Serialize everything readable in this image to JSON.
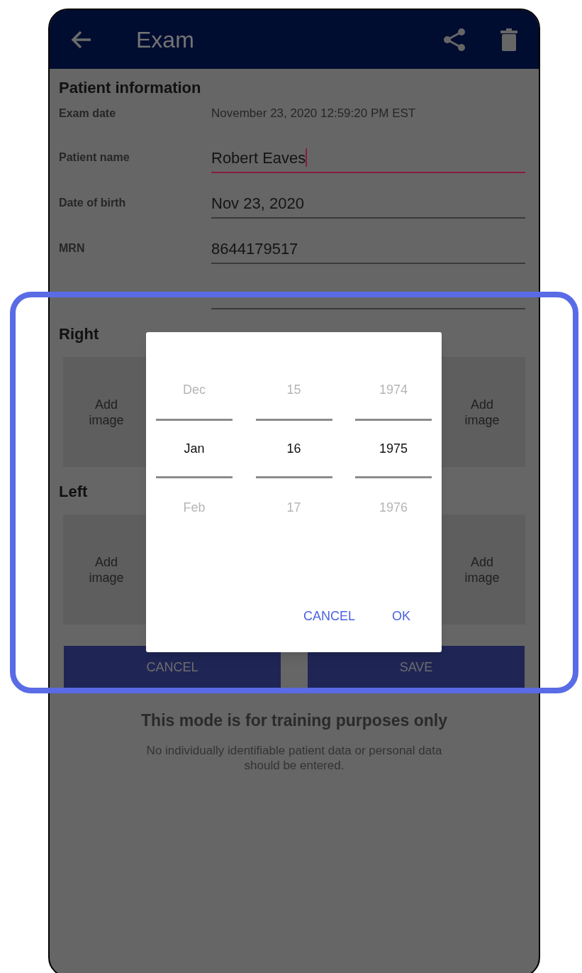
{
  "header": {
    "title": "Exam"
  },
  "section_title": "Patient information",
  "fields": [
    {
      "kind": "static",
      "label": "Exam date",
      "value": "November 23, 2020 12:59:20 PM EST"
    },
    {
      "kind": "input",
      "label": "Patient name",
      "value": "Robert Eaves",
      "focused": true
    },
    {
      "kind": "input",
      "label": "Date of birth",
      "value": "Nov 23, 2020",
      "focused": false
    },
    {
      "kind": "input",
      "label": "MRN",
      "value": "8644179517",
      "focused": false
    },
    {
      "kind": "input",
      "focused": false
    }
  ],
  "image_groups": [
    {
      "title": "Right",
      "tiles": [
        "Add image",
        "Add image"
      ]
    },
    {
      "title": "Left",
      "tiles": [
        "Add image",
        "Add image"
      ]
    }
  ],
  "buttons": [
    "CANCEL",
    "SAVE"
  ],
  "notice": {
    "title": "This mode is for training purposes only",
    "text": "No individually identifiable patient data or personal data should be entered."
  },
  "date_dialog": {
    "columns": [
      [
        {
          "text": "Dec",
          "selected": false
        },
        {
          "text": "Jan",
          "selected": true
        },
        {
          "text": "Feb",
          "selected": false
        }
      ],
      [
        {
          "text": "15",
          "selected": false
        },
        {
          "text": "16",
          "selected": true
        },
        {
          "text": "17",
          "selected": false
        }
      ],
      [
        {
          "text": "1974",
          "selected": false
        },
        {
          "text": "1975",
          "selected": true
        },
        {
          "text": "1976",
          "selected": false
        }
      ]
    ],
    "buttons": [
      "CANCEL",
      "OK"
    ]
  }
}
